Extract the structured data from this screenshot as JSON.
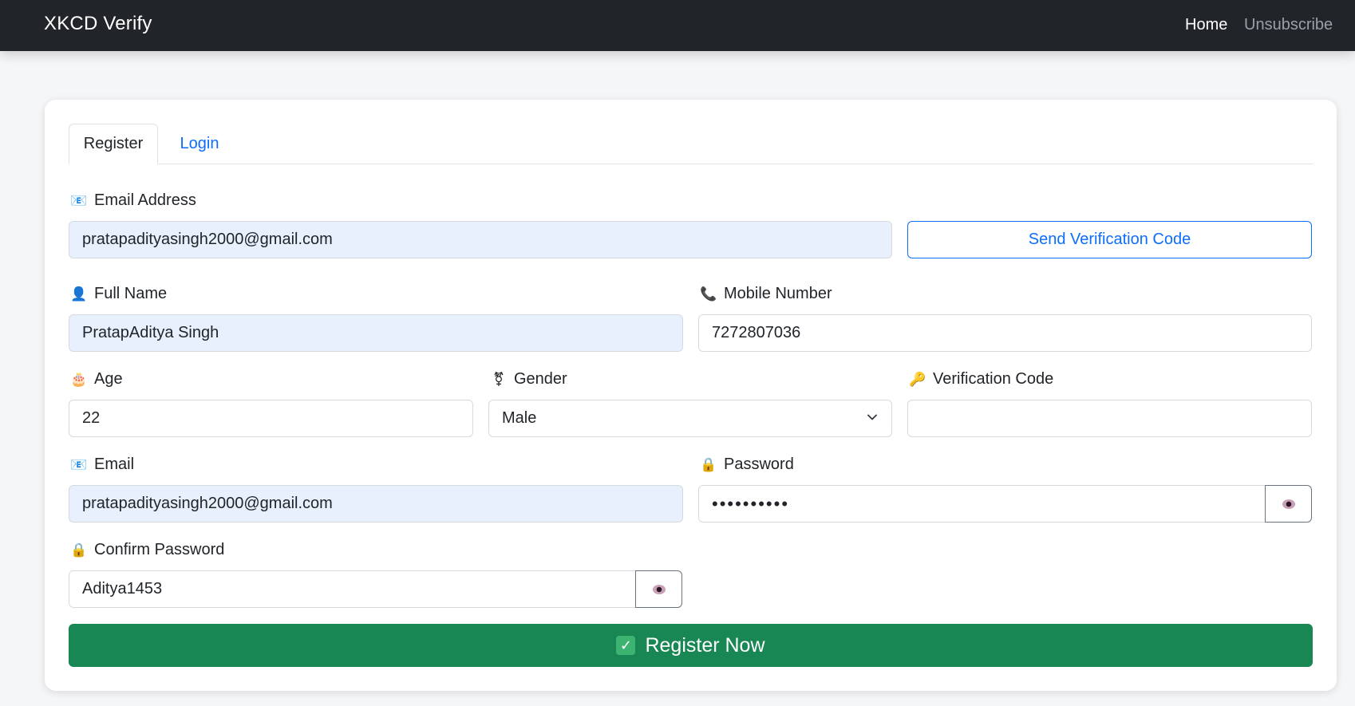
{
  "nav": {
    "brand": "XKCD Verify",
    "links": [
      {
        "label": "Home"
      },
      {
        "label": "Unsubscribe"
      }
    ]
  },
  "tabs": [
    {
      "label": "Register",
      "active": true
    },
    {
      "label": "Login",
      "active": false
    }
  ],
  "form": {
    "email_address": {
      "label": "Email Address",
      "icon": "email-icon",
      "value": "pratapadityasingh2000@gmail.com"
    },
    "send_code_label": "Send Verification Code",
    "full_name": {
      "label": "Full Name",
      "icon": "user-icon",
      "value": "PratapAditya Singh"
    },
    "mobile": {
      "label": "Mobile Number",
      "icon": "phone-icon",
      "value": "7272807036"
    },
    "age": {
      "label": "Age",
      "icon": "cake-icon",
      "value": "22"
    },
    "gender": {
      "label": "Gender",
      "icon": "gender-icon",
      "value": "Male"
    },
    "verification_code": {
      "label": "Verification Code",
      "icon": "key-icon",
      "value": ""
    },
    "email": {
      "label": "Email",
      "icon": "email-icon",
      "value": "pratapadityasingh2000@gmail.com"
    },
    "password": {
      "label": "Password",
      "icon": "lock-icon",
      "value": "••••••••••"
    },
    "confirm_password": {
      "label": "Confirm Password",
      "icon": "lock-icon",
      "value": "Aditya1453"
    },
    "submit_label": "Register Now"
  },
  "colors": {
    "navbar": "#212529",
    "primary": "#0d6efd",
    "success": "#198754",
    "autofill": "#e8f0fe"
  }
}
